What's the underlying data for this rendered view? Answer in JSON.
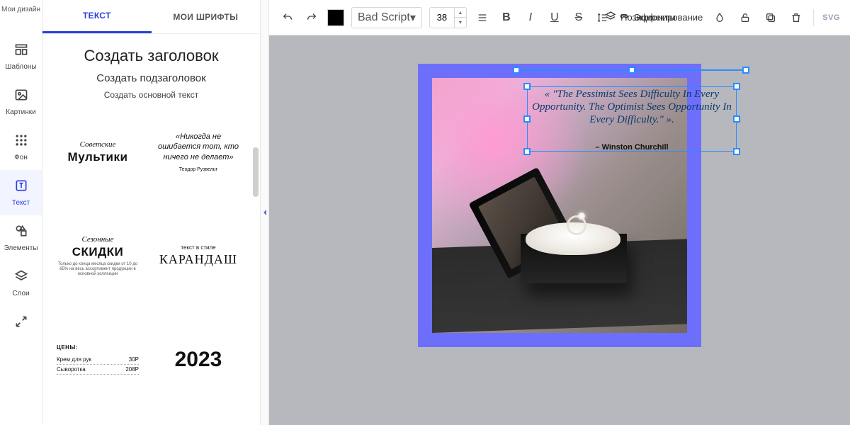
{
  "header_crumb": "Мои дизайн",
  "rail": [
    {
      "id": "templates",
      "label": "Шаблоны"
    },
    {
      "id": "images",
      "label": "Картинки"
    },
    {
      "id": "background",
      "label": "Фон"
    },
    {
      "id": "text",
      "label": "Текст"
    },
    {
      "id": "elements",
      "label": "Элементы"
    },
    {
      "id": "layers",
      "label": "Слои"
    },
    {
      "id": "resize",
      "label": ""
    }
  ],
  "rail_active": "text",
  "panel": {
    "tabs": {
      "text": "ТЕКСТ",
      "my_fonts": "МОИ ШРИФТЫ",
      "active": "text"
    },
    "create": {
      "heading": "Создать заголовок",
      "subheading": "Создать подзаголовок",
      "body": "Создать основной текст"
    },
    "presets": [
      {
        "id": "multiki",
        "l1": "Советские",
        "l2": "Мультики"
      },
      {
        "id": "quote",
        "text": "«Никогда не ошибается тот, кто ничего не делает»",
        "author": "Теодор Рузвельт"
      },
      {
        "id": "skidki",
        "l1": "Сезонные",
        "l2": "СКИДКИ",
        "cap": "Только до конца месяца скидки от 10 до 65% на весь ассортимент продукции в основной коллекции"
      },
      {
        "id": "karandash",
        "l1": "текст в стиле",
        "l2": "КАРАНДАШ"
      },
      {
        "id": "prices",
        "hdr": "ЦЕНЫ:",
        "rows": [
          [
            "Крем для рук",
            "30Р"
          ],
          [
            "Сыворотка",
            "208Р"
          ]
        ]
      },
      {
        "id": "year",
        "text": "2023"
      }
    ]
  },
  "toolbar": {
    "color": "#000000",
    "font": "Bad Script",
    "size": "38",
    "effects": "Эффекты",
    "position": "Позиционирование",
    "svg": "SVG"
  },
  "canvas": {
    "quote": "« \"The Pessimist Sees Difficulty In Every Opportunity. The Optimist Sees Opportunity In Every Difficulty.\" ».",
    "author": "– Winston Churchill"
  }
}
